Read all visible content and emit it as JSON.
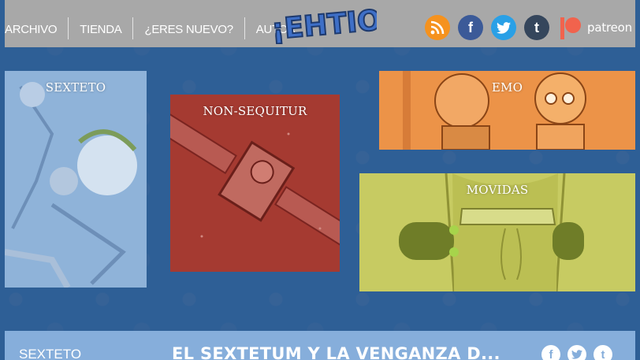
{
  "nav": {
    "items": [
      {
        "label": "ARCHIVO"
      },
      {
        "label": "TIENDA"
      },
      {
        "label": "¿ERES NUEVO?"
      },
      {
        "label": "AUTOR"
      }
    ]
  },
  "logo": {
    "text": "¡EHTIO!"
  },
  "social": {
    "rss_color": "#f5921e",
    "facebook_color": "#3b5a98",
    "twitter_color": "#2aa0e6",
    "tumblr_color": "#35465c",
    "patreon_color": "#f1634d",
    "patreon_label": "patreon"
  },
  "tiles": [
    {
      "title": "SEXTETO",
      "color": "#8fb3d9"
    },
    {
      "title": "NON-SEQUITUR",
      "color": "#a53a31"
    },
    {
      "title": "EMO",
      "color": "#ec9348"
    },
    {
      "title": "MOVIDAS",
      "color": "#c7cb62"
    }
  ],
  "bottom": {
    "section": "SEXTETO",
    "title": "EL SEXTETUM Y LA VENGANZA D..."
  }
}
